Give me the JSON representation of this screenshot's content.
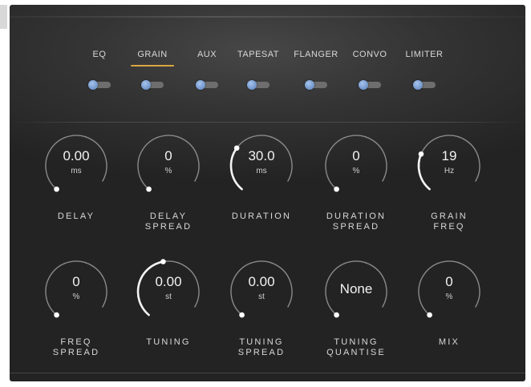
{
  "tabs": [
    {
      "label": "EQ",
      "active": false
    },
    {
      "label": "GRAIN",
      "active": true
    },
    {
      "label": "AUX",
      "active": false
    },
    {
      "label": "TAPESAT",
      "active": false
    },
    {
      "label": "FLANGER",
      "active": false
    },
    {
      "label": "CONVO",
      "active": false
    },
    {
      "label": "LIMITER",
      "active": false
    }
  ],
  "toggles": [
    false,
    false,
    false,
    false,
    false,
    false,
    false
  ],
  "colors": {
    "accent": "#d9a741",
    "toggle_thumb": "#7b9ed2",
    "track": "#6e6e6e"
  },
  "knobs_row1": [
    {
      "value": "0.00",
      "unit": "ms",
      "label": "DELAY",
      "level": 0.0
    },
    {
      "value": "0",
      "unit": "%",
      "label": "DELAY\nSPREAD",
      "level": 0.0
    },
    {
      "value": "30.0",
      "unit": "ms",
      "label": "DURATION",
      "level": 0.33
    },
    {
      "value": "0",
      "unit": "%",
      "label": "DURATION\nSPREAD",
      "level": 0.0
    },
    {
      "value": "19",
      "unit": "Hz",
      "label": "GRAIN\nFREQ",
      "level": 0.28
    }
  ],
  "knobs_row2": [
    {
      "value": "0",
      "unit": "%",
      "label": "FREQ\nSPREAD",
      "level": 0.0
    },
    {
      "value": "0.00",
      "unit": "st",
      "label": "TUNING",
      "level": 0.5
    },
    {
      "value": "0.00",
      "unit": "st",
      "label": "TUNING\nSPREAD",
      "level": 0.0
    },
    {
      "value": "None",
      "unit": "",
      "label": "TUNING\nQUANTISE",
      "level": 0.0
    },
    {
      "value": "0",
      "unit": "%",
      "label": "MIX",
      "level": 0.0
    }
  ]
}
